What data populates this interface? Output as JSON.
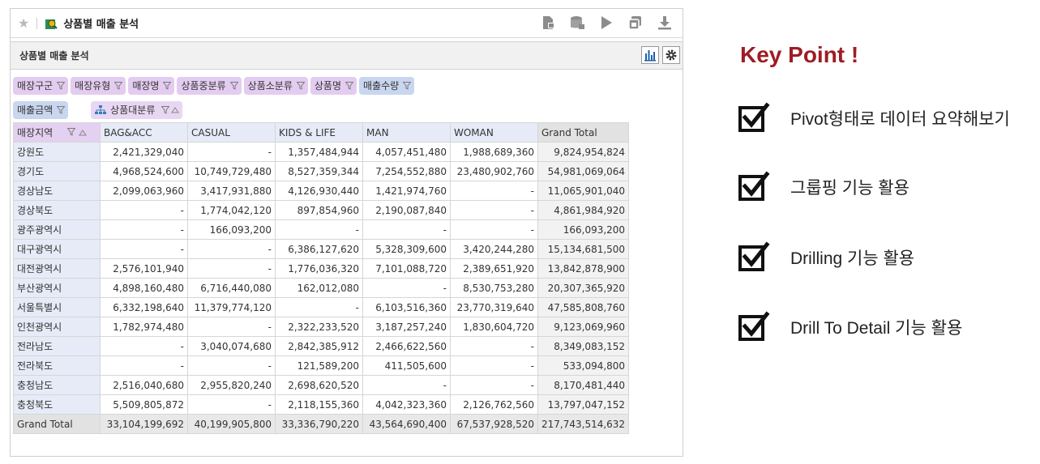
{
  "header": {
    "title": "상품별 매출 분석"
  },
  "subheader": {
    "title": "상품별 매출 분석"
  },
  "filters": {
    "row1": [
      "매장구군",
      "매장유형",
      "매장명",
      "상품중분류",
      "상품소분류",
      "상품명"
    ],
    "value_chip": "매출수량",
    "row2_value_chip": "매출금액",
    "column_field": "상품대분류"
  },
  "table": {
    "row_header": "매장지역",
    "columns": [
      "BAG&ACC",
      "CASUAL",
      "KIDS & LIFE",
      "MAN",
      "WOMAN",
      "Grand Total"
    ],
    "rows": [
      {
        "label": "강원도",
        "values": [
          "2,421,329,040",
          "-",
          "1,357,484,944",
          "4,057,451,480",
          "1,988,689,360",
          "9,824,954,824"
        ]
      },
      {
        "label": "경기도",
        "values": [
          "4,968,524,600",
          "10,749,729,480",
          "8,527,359,344",
          "7,254,552,880",
          "23,480,902,760",
          "54,981,069,064"
        ]
      },
      {
        "label": "경상남도",
        "values": [
          "2,099,063,960",
          "3,417,931,880",
          "4,126,930,440",
          "1,421,974,760",
          "-",
          "11,065,901,040"
        ]
      },
      {
        "label": "경상북도",
        "values": [
          "-",
          "1,774,042,120",
          "897,854,960",
          "2,190,087,840",
          "-",
          "4,861,984,920"
        ]
      },
      {
        "label": "광주광역시",
        "values": [
          "-",
          "166,093,200",
          "-",
          "-",
          "-",
          "166,093,200"
        ]
      },
      {
        "label": "대구광역시",
        "values": [
          "-",
          "-",
          "6,386,127,620",
          "5,328,309,600",
          "3,420,244,280",
          "15,134,681,500"
        ]
      },
      {
        "label": "대전광역시",
        "values": [
          "2,576,101,940",
          "-",
          "1,776,036,320",
          "7,101,088,720",
          "2,389,651,920",
          "13,842,878,900"
        ]
      },
      {
        "label": "부산광역시",
        "values": [
          "4,898,160,480",
          "6,716,440,080",
          "162,012,080",
          "-",
          "8,530,753,280",
          "20,307,365,920"
        ]
      },
      {
        "label": "서울특별시",
        "values": [
          "6,332,198,640",
          "11,379,774,120",
          "-",
          "6,103,516,360",
          "23,770,319,640",
          "47,585,808,760"
        ]
      },
      {
        "label": "인천광역시",
        "values": [
          "1,782,974,480",
          "-",
          "2,322,233,520",
          "3,187,257,240",
          "1,830,604,720",
          "9,123,069,960"
        ]
      },
      {
        "label": "전라남도",
        "values": [
          "-",
          "3,040,074,680",
          "2,842,385,912",
          "2,466,622,560",
          "-",
          "8,349,083,152"
        ]
      },
      {
        "label": "전라북도",
        "values": [
          "-",
          "-",
          "121,589,200",
          "411,505,600",
          "-",
          "533,094,800"
        ]
      },
      {
        "label": "충청남도",
        "values": [
          "2,516,040,680",
          "2,955,820,240",
          "2,698,620,520",
          "-",
          "-",
          "8,170,481,440"
        ]
      },
      {
        "label": "충청북도",
        "values": [
          "5,509,805,872",
          "-",
          "2,118,155,360",
          "4,042,323,360",
          "2,126,762,560",
          "13,797,047,152"
        ]
      }
    ],
    "grand_total": {
      "label": "Grand Total",
      "values": [
        "33,104,199,692",
        "40,199,905,800",
        "33,336,790,220",
        "43,564,690,400",
        "67,537,928,520",
        "217,743,514,632"
      ]
    }
  },
  "keypoint": {
    "title": "Key Point !",
    "items": [
      "Pivot형태로 데이터 요약해보기",
      "그룹핑 기능 활용",
      "Drilling 기능 활용",
      "Drill To Detail 기능 활용"
    ]
  },
  "colors": {
    "accent": "#9e1c24",
    "chip_purple": "#e3ccf0",
    "chip_blue": "#c9d6ef",
    "header_blue": "#e6ebf7"
  }
}
